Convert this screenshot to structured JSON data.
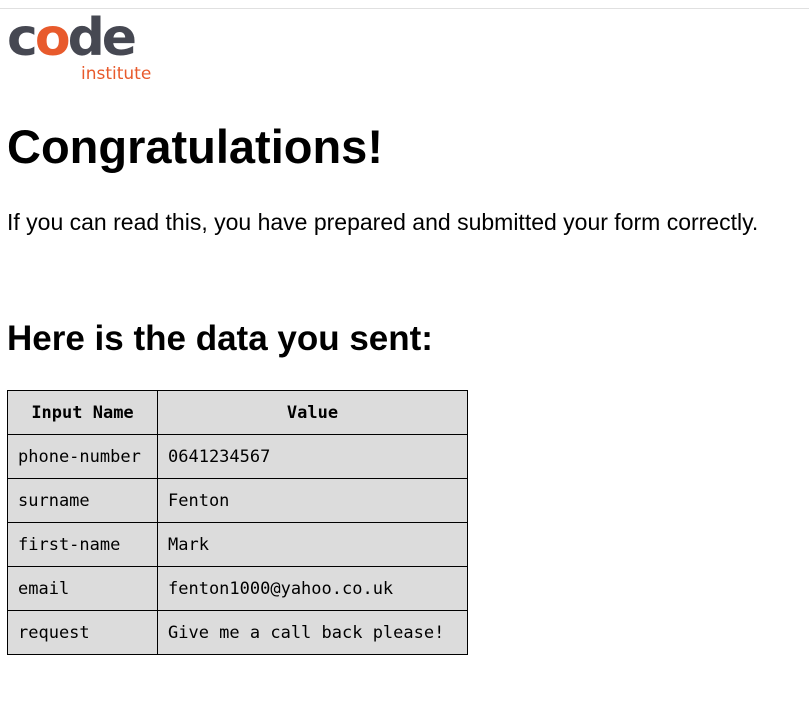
{
  "logo": {
    "word_before": "c",
    "word_accent": "o",
    "word_after": "de",
    "sub": "institute",
    "colors": {
      "dark": "#464852",
      "accent": "#e85a2c"
    }
  },
  "heading": "Congratulations!",
  "message": "If you can read this, you have prepared and submitted your form correctly.",
  "subheading": "Here is the data you sent:",
  "table": {
    "headers": [
      "Input Name",
      "Value"
    ],
    "rows": [
      {
        "name": "phone-number",
        "value": "0641234567"
      },
      {
        "name": "surname",
        "value": "Fenton"
      },
      {
        "name": "first-name",
        "value": "Mark"
      },
      {
        "name": "email",
        "value": "fenton1000@yahoo.co.uk"
      },
      {
        "name": "request",
        "value": "Give me a call back please!"
      }
    ]
  }
}
